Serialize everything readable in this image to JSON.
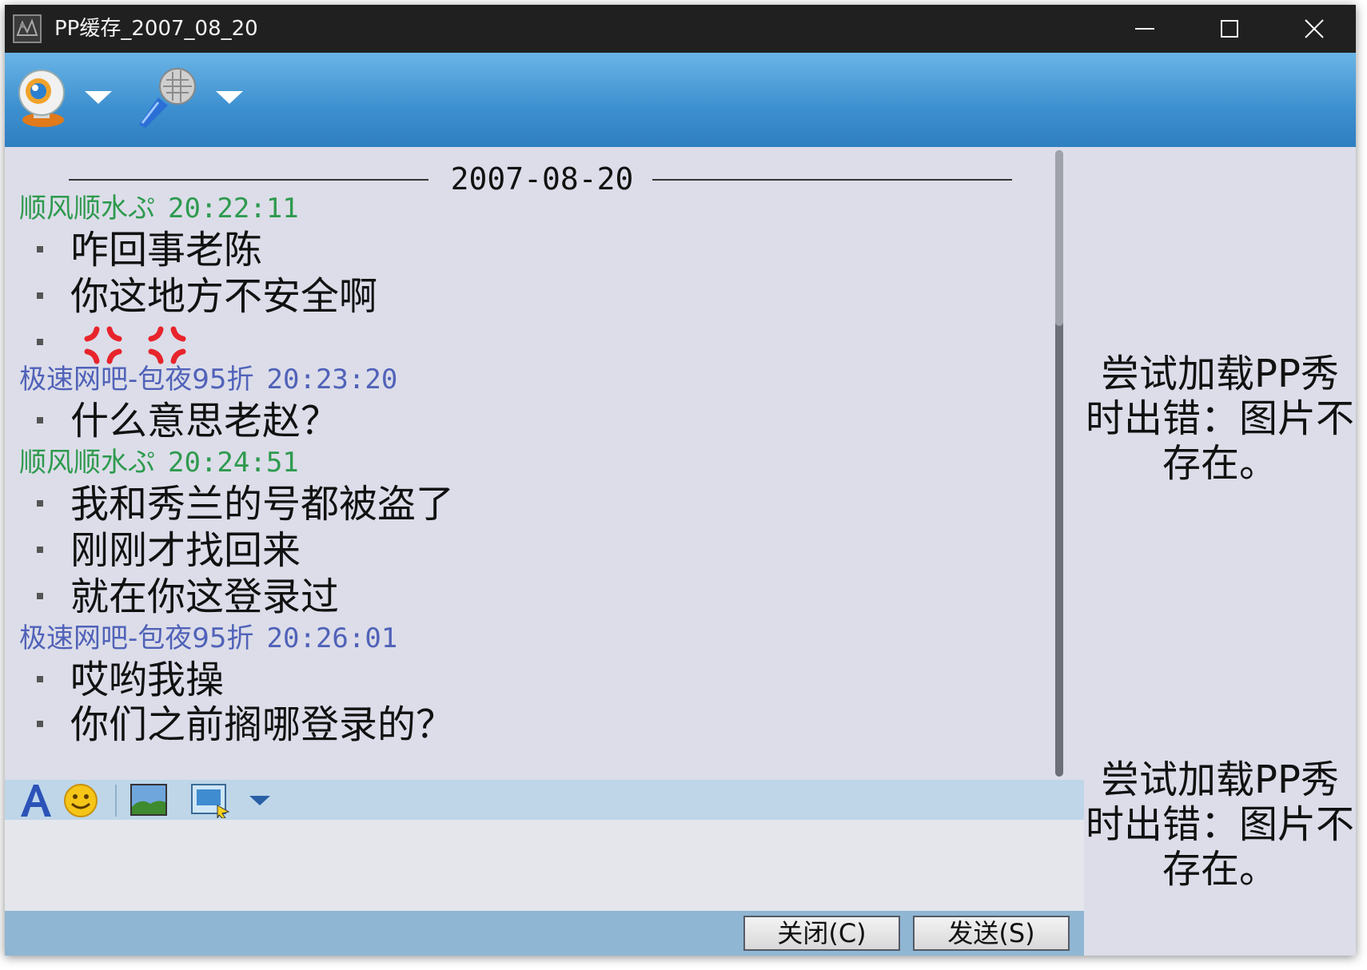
{
  "window": {
    "title": "PP缓存_2007_08_20"
  },
  "toolbar": {
    "webcam_icon": "webcam-icon",
    "mic_icon": "microphone-icon"
  },
  "chat": {
    "date": "2007-08-20",
    "messages": [
      {
        "sender": "顺风顺水ぷ",
        "time": "20:22:11",
        "color": "#2e9a4e",
        "lines": [
          "咋回事老陈",
          "你这地方不安全啊"
        ],
        "emoticons": [
          "angry-vein-icon",
          "angry-vein-icon"
        ]
      },
      {
        "sender": "极速网吧-包夜95折",
        "time": "20:23:20",
        "color": "#5062b8",
        "lines": [
          "什么意思老赵？"
        ]
      },
      {
        "sender": "顺风顺水ぷ",
        "time": "20:24:51",
        "color": "#2e9a4e",
        "lines": [
          "我和秀兰的号都被盗了",
          "刚刚才找回来",
          "就在你这登录过"
        ]
      },
      {
        "sender": "极速网吧-包夜95折",
        "time": "20:26:01",
        "color": "#5062b8",
        "lines": [
          "哎哟我操",
          "你们之前搁哪登录的？"
        ]
      }
    ]
  },
  "format_bar": {
    "font_icon": "font-icon",
    "emoji_icon": "smiley-icon",
    "image_icon": "image-icon",
    "screenshot_icon": "screenshot-icon"
  },
  "input": {
    "value": "",
    "placeholder": ""
  },
  "buttons": {
    "close_label": "关闭(C)",
    "send_label": "发送(S)"
  },
  "pp_show": {
    "error_top": "尝试加载PP秀时出错：图片不存在。",
    "error_bottom": "尝试加载PP秀时出错：图片不存在。"
  }
}
